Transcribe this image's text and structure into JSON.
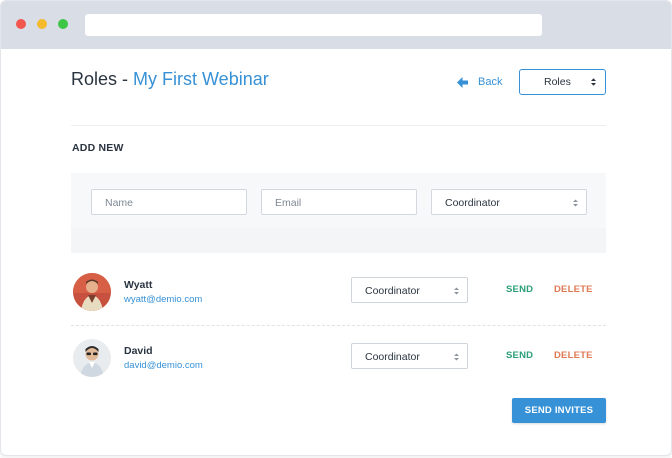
{
  "header": {
    "title_prefix": "Roles",
    "title_separator": " - ",
    "webinar_name": "My First Webinar",
    "back_label": "Back",
    "roles_dropdown_value": "Roles"
  },
  "add_new": {
    "section_label": "ADD NEW",
    "name_placeholder": "Name",
    "email_placeholder": "Email",
    "role_value": "Coordinator"
  },
  "users": [
    {
      "name": "Wyatt",
      "email": "wyatt@demio.com",
      "role": "Coordinator",
      "send_label": "SEND",
      "delete_label": "DELETE"
    },
    {
      "name": "David",
      "email": "david@demio.com",
      "role": "Coordinator",
      "send_label": "SEND",
      "delete_label": "DELETE"
    }
  ],
  "footer": {
    "send_invites_label": "SEND INVITES"
  },
  "colors": {
    "accent": "#3791d6",
    "send": "#2a9e79",
    "delete": "#e07a55",
    "text": "#2a3441"
  },
  "icons": {
    "back": "arrow-left-icon",
    "select": "chevron-updown-icon"
  }
}
